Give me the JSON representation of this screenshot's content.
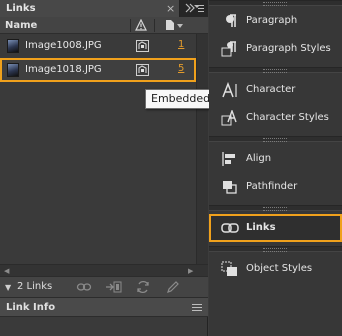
{
  "links_panel": {
    "tab_label": "Links",
    "close_glyph": "×",
    "column_headers": {
      "name": "Name"
    },
    "rows": [
      {
        "filename": "Image1008.JPG",
        "page": "1",
        "selected": false
      },
      {
        "filename": "Image1018.JPG",
        "page": "5",
        "selected": true
      }
    ],
    "tooltip": "Embedded",
    "footer": {
      "count": "2 Links"
    },
    "link_info_label": "Link Info"
  },
  "dock": {
    "items": [
      {
        "label": "Paragraph",
        "icon": "paragraph-icon"
      },
      {
        "label": "Paragraph Styles",
        "icon": "paragraph-styles-icon"
      },
      {
        "label": "Character",
        "icon": "character-icon"
      },
      {
        "label": "Character Styles",
        "icon": "character-styles-icon"
      },
      {
        "label": "Align",
        "icon": "align-icon"
      },
      {
        "label": "Pathfinder",
        "icon": "pathfinder-icon"
      },
      {
        "label": "Links",
        "icon": "links-icon",
        "active": true
      },
      {
        "label": "Object Styles",
        "icon": "object-styles-icon"
      }
    ]
  },
  "colors": {
    "highlight": "#f0a11c",
    "page_link": "#e39b2c",
    "panel_bg": "#3a3a3a"
  }
}
